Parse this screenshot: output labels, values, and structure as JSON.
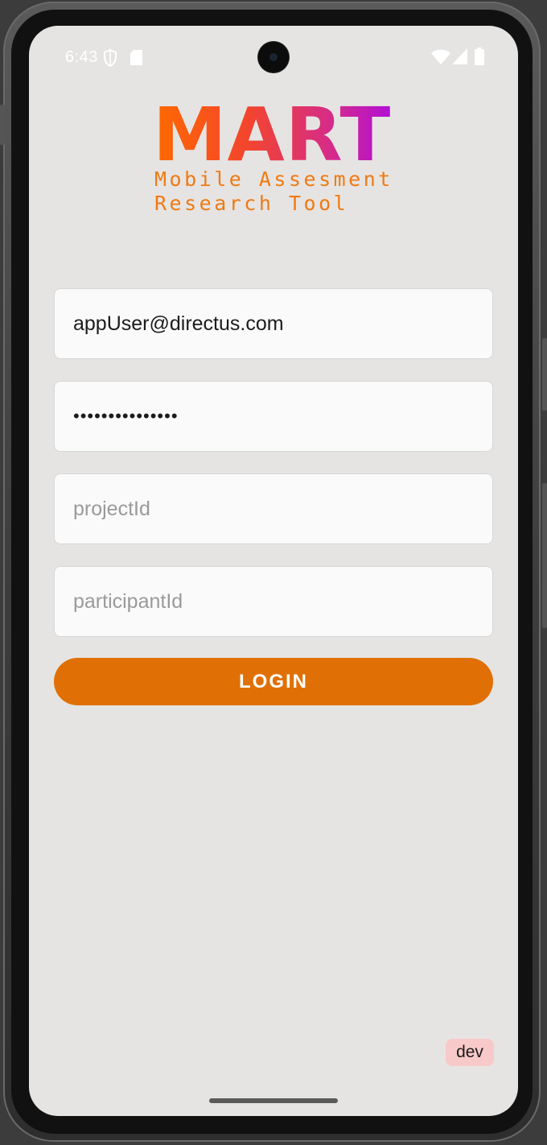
{
  "status_bar": {
    "time": "6:43",
    "icons": [
      "shield-icon",
      "sd-card-icon",
      "wifi-icon",
      "signal-icon",
      "battery-icon"
    ]
  },
  "logo": {
    "title": "MART",
    "subtitle_line1": "Mobile Assesment",
    "subtitle_line2": "Research Tool"
  },
  "form": {
    "email_value": "appUser@directus.com",
    "password_value": "•••••••••••••••",
    "project_placeholder": "projectId",
    "participant_placeholder": "participantId",
    "login_label": "LOGIN"
  },
  "env_badge": "dev",
  "colors": {
    "accent": "#e07005",
    "background": "#e6e4e2",
    "badge": "#f8c9c9"
  }
}
